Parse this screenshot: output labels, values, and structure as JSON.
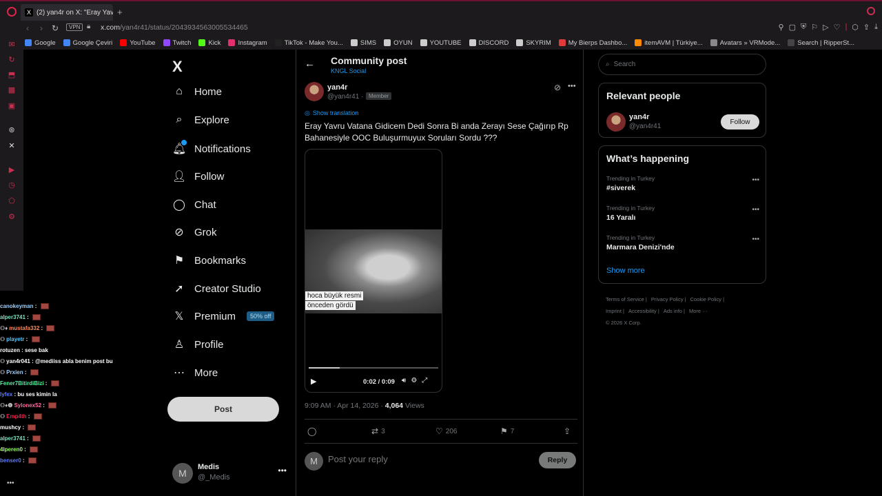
{
  "browser": {
    "tab_title": "(2) yan4r on X: \"Eray Yavru",
    "url_host": "x.com",
    "url_path": "/yan4r41/status/2043934563005534465",
    "vpn_label": "VPN",
    "bookmarks": [
      {
        "label": "Google",
        "color": "#4285f4"
      },
      {
        "label": "Google Çeviri",
        "color": "#4285f4"
      },
      {
        "label": "YouTube",
        "color": "#ff0000"
      },
      {
        "label": "Twitch",
        "color": "#9146ff"
      },
      {
        "label": "Kick",
        "color": "#53fc18"
      },
      {
        "label": "Instagram",
        "color": "#e1306c"
      },
      {
        "label": "TikTok - Make You...",
        "color": "#222222"
      },
      {
        "label": "SIMS",
        "color": "#cccccc"
      },
      {
        "label": "OYUN",
        "color": "#cccccc"
      },
      {
        "label": "YOUTUBE",
        "color": "#cccccc"
      },
      {
        "label": "DISCORD",
        "color": "#cccccc"
      },
      {
        "label": "SKYRIM",
        "color": "#cccccc"
      },
      {
        "label": "My Bierps Dashbo...",
        "color": "#e03a3a"
      },
      {
        "label": "itemAVM | Türkiye...",
        "color": "#ff8a00"
      },
      {
        "label": "Avatars » VRMode...",
        "color": "#888888"
      },
      {
        "label": "Search | RipperSt...",
        "color": "#444444"
      }
    ]
  },
  "nav": {
    "logo": "X",
    "items": [
      {
        "label": "Home",
        "icon": "⌂"
      },
      {
        "label": "Explore",
        "icon": "⌕"
      },
      {
        "label": "Notifications",
        "icon": "🔔︎"
      },
      {
        "label": "Follow",
        "icon": "👤︎"
      },
      {
        "label": "Chat",
        "icon": "◯"
      },
      {
        "label": "Grok",
        "icon": "⊘"
      },
      {
        "label": "Bookmarks",
        "icon": "⚑"
      },
      {
        "label": "Creator Studio",
        "icon": "➚"
      },
      {
        "label": "Premium",
        "icon": "𝕏"
      },
      {
        "label": "Profile",
        "icon": "♙"
      },
      {
        "label": "More",
        "icon": "⋯"
      }
    ],
    "premium_badge": "50% off",
    "post_button": "Post",
    "account": {
      "avatar_letter": "M",
      "name": "Medis",
      "handle": "@_Medis"
    }
  },
  "post": {
    "header_title": "Community post",
    "header_subtitle": "KNGL Social",
    "author_name": "yan4r",
    "author_handle": "@yan4r41 ·",
    "member_badge": "Member",
    "show_translation": "Show translation",
    "text": "Eray Yavru Vatana Gidicem Dedi Sonra Bi anda Zerayı Sese Çağırıp Rp Bahanesiyle OOC Buluşurmuyux Soruları Sordu ???",
    "video": {
      "caption_line1": "hoca büyük resmi",
      "caption_line2": "önceden gördü",
      "time": "0:02 / 0:09",
      "progress": 0.24
    },
    "timestamp": "9:09 AM · Apr 14, 2026 ·",
    "views_count": "4,064",
    "views_label": "Views",
    "actions": {
      "reposts": "3",
      "likes": "206",
      "bookmarks": "7"
    },
    "reply": {
      "avatar_letter": "M",
      "placeholder": "Post your reply",
      "button": "Reply"
    }
  },
  "sidebar": {
    "search_placeholder": "Search",
    "relevant": {
      "title": "Relevant people",
      "name": "yan4r",
      "handle": "@yan4r41",
      "follow": "Follow"
    },
    "happening": {
      "title": "What’s happening",
      "trends": [
        {
          "context": "Trending in Turkey",
          "name": "#siverek"
        },
        {
          "context": "Trending in Turkey",
          "name": "16 Yaralı"
        },
        {
          "context": "Trending in Turkey",
          "name": "Marmara Denizi'nde"
        }
      ],
      "show_more": "Show more"
    },
    "footer_links": [
      "Terms of Service |",
      "Privacy Policy |",
      "Cookie Policy |",
      "Imprint |",
      "Accessibility |",
      "Ads info |",
      "More ···"
    ],
    "copyright": "© 2026 X Corp."
  },
  "chat": [
    {
      "user": "canokeyman",
      "color": "#9ad0ff",
      "msg": ""
    },
    {
      "user": "alper3741",
      "color": "#7ee0c0",
      "msg": ""
    },
    {
      "user": "mustafa332",
      "color": "#ff8a5c",
      "msg": "",
      "badge": "⚇♦"
    },
    {
      "user": "playetr",
      "color": "#57c8ff",
      "msg": "",
      "badge": "⚇"
    },
    {
      "user": "rotuzen",
      "color": "#ffffff",
      "msg": "sese bak"
    },
    {
      "user": "yan4r041",
      "color": "#ffffff",
      "msg": "@mediiss abla benim post bu",
      "badge": "⚇"
    },
    {
      "user": "Prxien",
      "color": "#9ad0ff",
      "msg": "",
      "badge": "⚇"
    },
    {
      "user": "Fener7BitirdiBizi",
      "color": "#53f0a0",
      "msg": ""
    },
    {
      "user": "lyfex",
      "color": "#5b7cff",
      "msg": "bu ses kimin la"
    },
    {
      "user": "Sylonex52",
      "color": "#ff6aa0",
      "msg": "",
      "badge": "⚇♦❶"
    },
    {
      "user": "Emp4th",
      "color": "#e0244b",
      "msg": "",
      "badge": "⚇"
    },
    {
      "user": "mushcy",
      "color": "#ffffff",
      "msg": ""
    },
    {
      "user": "alper3741",
      "color": "#7ee0c0",
      "msg": ""
    },
    {
      "user": "4lperen0",
      "color": "#9bff6a",
      "msg": ""
    },
    {
      "user": "benser0",
      "color": "#5b7cff",
      "msg": ""
    }
  ],
  "colors": {
    "accent": "#1d9bf0",
    "opera_red": "#e0244b"
  }
}
